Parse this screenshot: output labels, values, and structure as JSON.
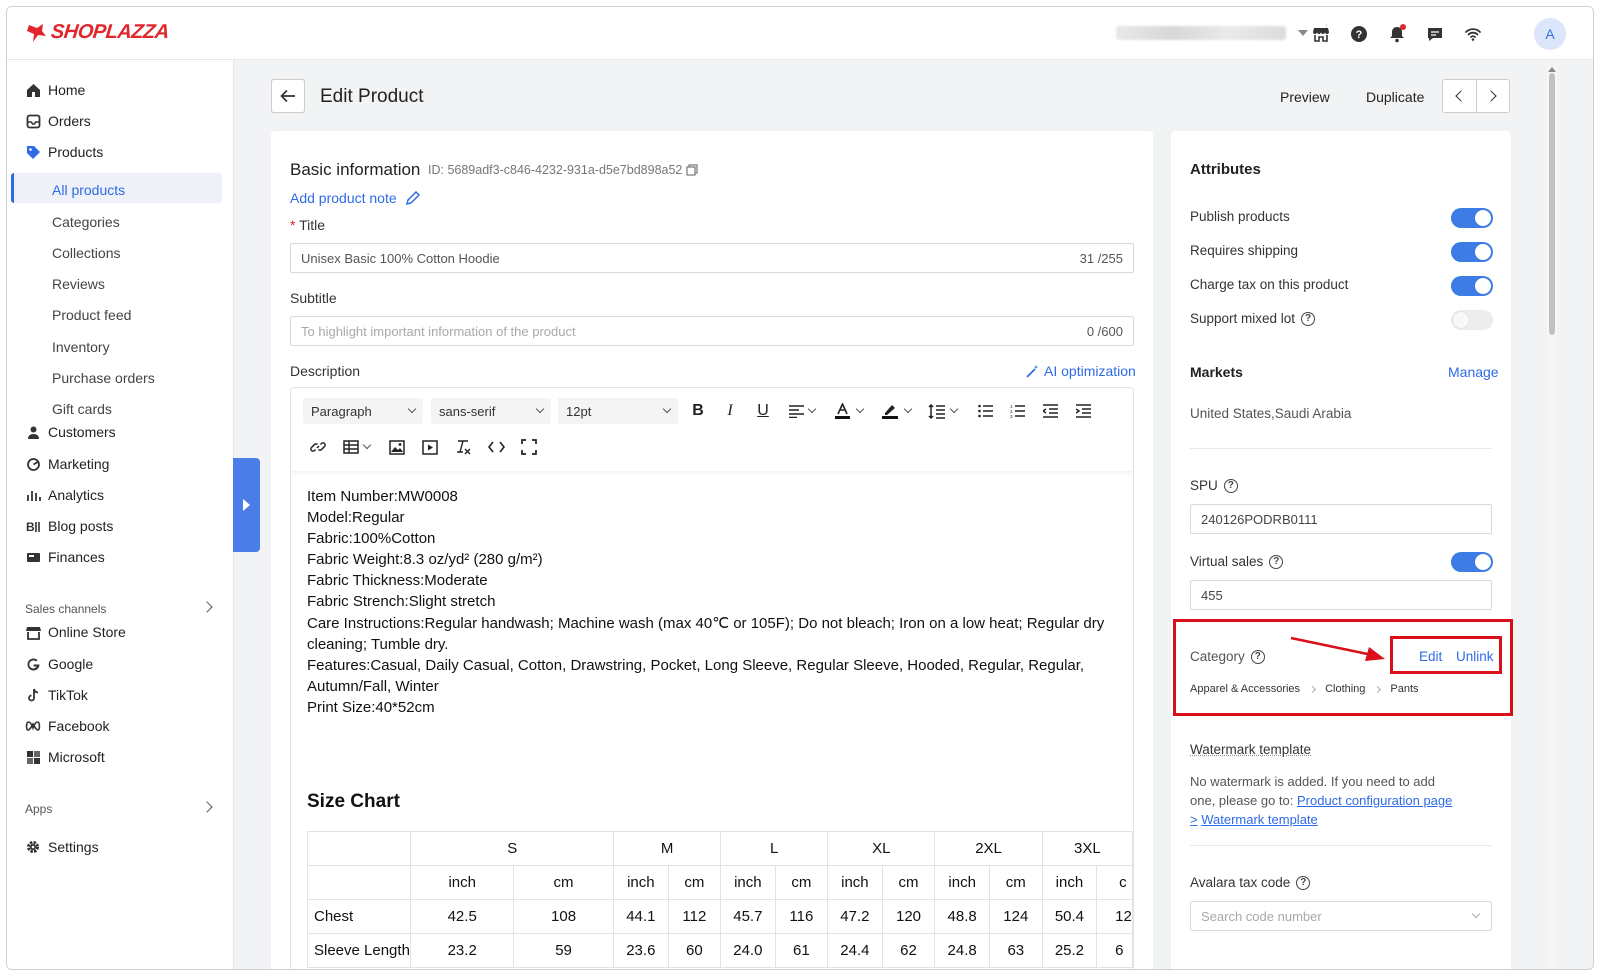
{
  "brand": {
    "name": "SHOPLAZZA",
    "color": "#e0262b"
  },
  "topbar": {
    "avatar_letter": "A",
    "icons": [
      "store-icon",
      "help-icon",
      "bell-icon",
      "message-icon",
      "wifi-icon"
    ]
  },
  "sidebar": {
    "items": [
      {
        "label": "Home",
        "icon": "home-icon"
      },
      {
        "label": "Orders",
        "icon": "orders-icon"
      },
      {
        "label": "Products",
        "icon": "tag-icon"
      }
    ],
    "product_subitems": [
      "All products",
      "Categories",
      "Collections",
      "Reviews",
      "Product feed",
      "Inventory",
      "Purchase orders",
      "Gift cards"
    ],
    "items2": [
      {
        "label": "Customers",
        "icon": "user-icon"
      },
      {
        "label": "Marketing",
        "icon": "marketing-icon"
      },
      {
        "label": "Analytics",
        "icon": "analytics-icon"
      },
      {
        "label": "Blog posts",
        "icon": "blog-icon"
      },
      {
        "label": "Finances",
        "icon": "finance-icon"
      }
    ],
    "sales_channels_title": "Sales channels",
    "channels": [
      {
        "label": "Online Store",
        "icon": "online-store-icon"
      },
      {
        "label": "Google",
        "icon": "google-icon"
      },
      {
        "label": "TikTok",
        "icon": "tiktok-icon"
      },
      {
        "label": "Facebook",
        "icon": "meta-icon"
      },
      {
        "label": "Microsoft",
        "icon": "microsoft-icon"
      }
    ],
    "apps_title": "Apps",
    "settings_label": "Settings"
  },
  "header": {
    "title": "Edit Product",
    "preview": "Preview",
    "duplicate": "Duplicate"
  },
  "basic": {
    "title": "Basic information",
    "id": "ID: 5689adf3-c846-4232-931a-d5e7bd898a52",
    "add_note": "Add product note",
    "title_label": "Title",
    "title_value": "Unisex Basic 100% Cotton Hoodie",
    "title_count": "31 /255",
    "subtitle_label": "Subtitle",
    "subtitle_placeholder": "To highlight important information of the product",
    "subtitle_count": "0 /600",
    "description_label": "Description",
    "ai_optimization": "AI optimization"
  },
  "editor": {
    "block_format": "Paragraph",
    "font_family": "sans-serif",
    "font_size": "12pt",
    "lines": [
      "Item Number:MW0008",
      "Model:Regular",
      "Fabric:100%Cotton",
      "Fabric Weight:8.3 oz/yd² (280 g/m²)",
      "Fabric Thickness:Moderate",
      "Fabric Strench:Slight stretch",
      "Care Instructions:Regular handwash; Machine wash (max 40℃ or 105F); Do not bleach; Iron on a low heat; Regular dry cleaning; Tumble dry.",
      "Features:Casual, Daily Casual, Cotton, Drawstring, Pocket, Long Sleeve, Regular Sleeve, Hooded, Regular, Regular, Autumn/Fall, Winter",
      "Print Size:40*52cm"
    ],
    "size_chart_title": "Size Chart",
    "sizes": [
      "S",
      "M",
      "L",
      "XL",
      "2XL",
      "3XL"
    ],
    "units": [
      "inch",
      "cm"
    ],
    "rows": [
      {
        "name": "Chest",
        "values": [
          "42.5",
          "108",
          "44.1",
          "112",
          "45.7",
          "116",
          "47.2",
          "120",
          "48.8",
          "124",
          "50.4",
          "12"
        ]
      },
      {
        "name": "Sleeve Length",
        "values": [
          "23.2",
          "59",
          "23.6",
          "60",
          "24.0",
          "61",
          "24.4",
          "62",
          "24.8",
          "63",
          "25.2",
          "6"
        ]
      }
    ]
  },
  "attributes": {
    "title": "Attributes",
    "toggles": [
      {
        "label": "Publish products",
        "on": true
      },
      {
        "label": "Requires shipping",
        "on": true
      },
      {
        "label": "Charge tax on this product",
        "on": true
      },
      {
        "label": "Support mixed lot",
        "on": false
      }
    ],
    "markets_label": "Markets",
    "markets_manage": "Manage",
    "markets_value": "United States,Saudi Arabia",
    "spu_label": "SPU",
    "spu_value": "240126PODRB0111",
    "virtual_sales_label": "Virtual sales",
    "virtual_sales_value": "455",
    "category_label": "Category",
    "category_edit": "Edit",
    "category_unlink": "Unlink",
    "category_path": [
      "Apparel & Accessories",
      "Clothing",
      "Pants"
    ],
    "watermark_label": "Watermark template",
    "watermark_text": "No watermark is added. If you need to add one, please go to:",
    "watermark_link1": "Product configuration page >",
    "watermark_link2": "Watermark template",
    "avalara_label": "Avalara tax code",
    "avalara_placeholder": "Search code number"
  },
  "colors": {
    "accent": "#2f6be6",
    "highlight": "#d9101a"
  }
}
